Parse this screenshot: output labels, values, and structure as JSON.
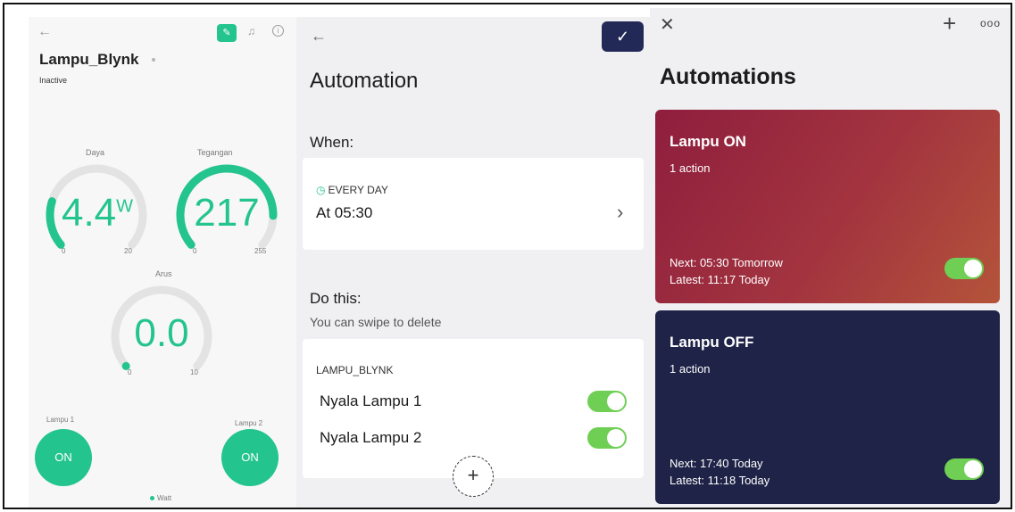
{
  "panel1": {
    "device_title": "Lampu_Blynk",
    "status": "Inactive",
    "gauges": [
      {
        "label": "Daya",
        "value": "4.4",
        "unit": "W",
        "min": "0",
        "max": "20",
        "level": 0.22
      },
      {
        "label": "Tegangan",
        "value": "217",
        "unit": "",
        "min": "0",
        "max": "255",
        "level": 0.85
      },
      {
        "label": "Arus",
        "value": "0.0",
        "unit": "",
        "min": "0",
        "max": "10",
        "level": 0.0
      }
    ],
    "lamps": [
      {
        "label": "Lampu 1",
        "button": "ON"
      },
      {
        "label": "Lampu 2",
        "button": "ON"
      }
    ],
    "legend": "Watt",
    "accent_color": "#23c48e"
  },
  "panel2": {
    "title": "Automation",
    "when_label": "When:",
    "schedule": {
      "repeat": "EVERY DAY",
      "time": "At 05:30"
    },
    "do_label": "Do this:",
    "swipe_hint": "You can swipe to delete",
    "device": "LAMPU_BLYNK",
    "actions": [
      {
        "label": "Nyala Lampu 1",
        "enabled": true
      },
      {
        "label": "Nyala Lampu 2",
        "enabled": true
      }
    ],
    "confirm_color": "#232957"
  },
  "panel3": {
    "title": "Automations",
    "cards": [
      {
        "name": "Lampu ON",
        "actions": "1 action",
        "next": "Next: 05:30 Tomorrow",
        "latest": "Latest: 11:17 Today",
        "enabled": true
      },
      {
        "name": "Lampu OFF",
        "actions": "1 action",
        "next": "Next: 17:40 Today",
        "latest": "Latest: 11:18 Today",
        "enabled": true
      }
    ]
  }
}
